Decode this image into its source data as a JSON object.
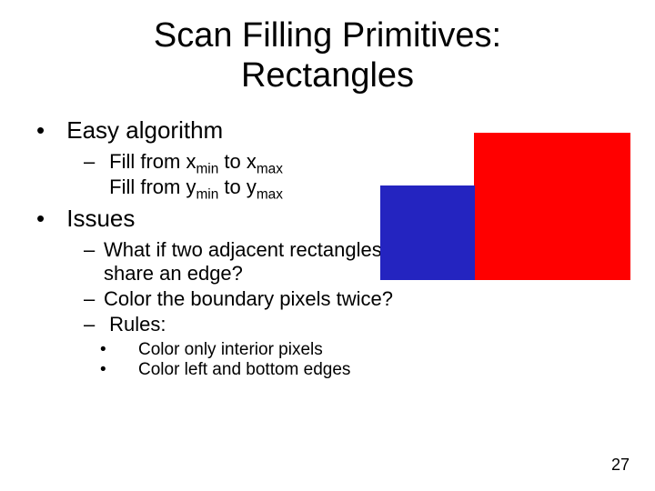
{
  "title_line1": "Scan Filling Primitives:",
  "title_line2": "Rectangles",
  "bullets": {
    "b1": "Easy algorithm",
    "b1_sub1_pre": "Fill from x",
    "b1_sub1_s1": "min",
    "b1_sub1_mid": " to x",
    "b1_sub1_s2": "max",
    "b1_sub2_pre": "Fill from y",
    "b1_sub2_s1": "min",
    "b1_sub2_mid": " to y",
    "b1_sub2_s2": "max",
    "b2": "Issues",
    "b2_sub1": "What if two adjacent rectangles share an edge?",
    "b2_sub2": "Color the boundary pixels twice?",
    "b2_sub3": "Rules:",
    "b2_sub3_a": "Color only interior pixels",
    "b2_sub3_b": "Color left and bottom edges"
  },
  "figure": {
    "red_color": "#ff0000",
    "blue_color": "#2424c0"
  },
  "page_number": "27"
}
